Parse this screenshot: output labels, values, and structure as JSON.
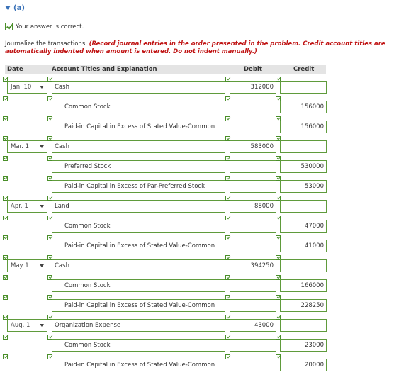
{
  "part_label": "(a)",
  "correct_text": "Your answer is correct.",
  "instructions_plain": "Journalize the transactions.",
  "instructions_emphasis": "(Record journal entries in the order presented in the problem. Credit account titles are automatically indented when amount is entered. Do not indent manually.)",
  "headers": {
    "date": "Date",
    "account": "Account Titles and Explanation",
    "debit": "Debit",
    "credit": "Credit"
  },
  "rows": [
    {
      "date": "Jan. 10",
      "account": "Cash",
      "debit": "312000",
      "credit": ""
    },
    {
      "date": "",
      "account": "Common Stock",
      "debit": "",
      "credit": "156000"
    },
    {
      "date": "",
      "account": "Paid-in Capital in Excess of Stated Value-Common",
      "debit": "",
      "credit": "156000"
    },
    {
      "date": "Mar. 1",
      "account": "Cash",
      "debit": "583000",
      "credit": ""
    },
    {
      "date": "",
      "account": "Preferred Stock",
      "debit": "",
      "credit": "530000"
    },
    {
      "date": "",
      "account": "Paid-in Capital in Excess of Par-Preferred Stock",
      "debit": "",
      "credit": "53000"
    },
    {
      "date": "Apr. 1",
      "account": "Land",
      "debit": "88000",
      "credit": ""
    },
    {
      "date": "",
      "account": "Common Stock",
      "debit": "",
      "credit": "47000"
    },
    {
      "date": "",
      "account": "Paid-in Capital in Excess of Stated Value-Common",
      "debit": "",
      "credit": "41000"
    },
    {
      "date": "May 1",
      "account": "Cash",
      "debit": "394250",
      "credit": ""
    },
    {
      "date": "",
      "account": "Common Stock",
      "debit": "",
      "credit": "166000"
    },
    {
      "date": "",
      "account": "Paid-in Capital in Excess of Stated Value-Common",
      "debit": "",
      "credit": "228250"
    },
    {
      "date": "Aug. 1",
      "account": "Organization Expense",
      "debit": "43000",
      "credit": ""
    },
    {
      "date": "",
      "account": "Common Stock",
      "debit": "",
      "credit": "23000"
    },
    {
      "date": "",
      "account": "Paid-in Capital in Excess of Stated Value-Common",
      "debit": "",
      "credit": "20000"
    }
  ]
}
